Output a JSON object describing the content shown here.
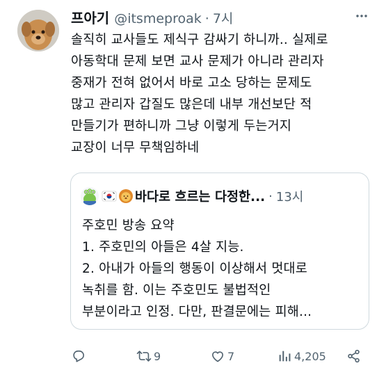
{
  "tweet": {
    "author_name": "프아기",
    "handle": "@itsmeproak",
    "separator": "·",
    "time": "7시",
    "lines": [
      "솔직히 교사들도 제식구 감싸기 하니까.. 실제로",
      "아동학대 문제 보면 교사 문제가 아니라 관리자",
      "중재가 전혀 없어서 바로 고소 당하는 문제도",
      "많고 관리자 갑질도 많은데 내부 개선보단 적",
      "만들기가 편하니까 그냥 이렇게 두는거지",
      "교장이 너무 무책임하네"
    ]
  },
  "quoted": {
    "author_name": "바다로 흐르는 다정한...",
    "separator": "·",
    "time": "13시",
    "lines": [
      "주호민 방송 요약",
      "1. 주호민의 아들은 4살 지능.",
      "2. 아내가 아들의 행동이 이상해서 멋대로",
      "녹취를 함. 이는 주호민도 불법적인",
      "부분이라고 인정. 다만, 판결문에는 피해..."
    ]
  },
  "actions": {
    "reply_count": "",
    "retweet_count": "9",
    "like_count": "7",
    "views_count": "4,205"
  },
  "icons": {
    "more": "more-icon",
    "reply": "reply-icon",
    "retweet": "retweet-icon",
    "like": "like-icon",
    "views": "views-icon",
    "share": "share-icon"
  },
  "colors": {
    "text": "#0f1419",
    "secondary": "#536471",
    "border": "#cfd9de"
  }
}
